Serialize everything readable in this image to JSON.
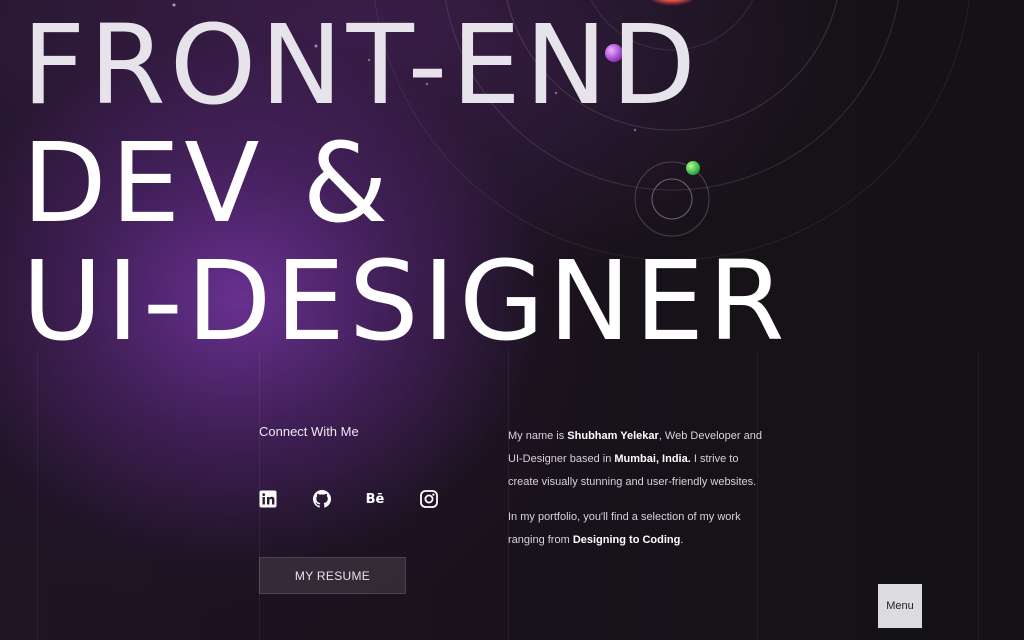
{
  "hero": {
    "line1": "FRONT-END",
    "line2": "DEV &",
    "line3": "UI-DESIGNER"
  },
  "connect": {
    "title": "Connect With Me",
    "socials": [
      {
        "icon": "linkedin-icon",
        "label": "in"
      },
      {
        "icon": "github-icon",
        "label": ""
      },
      {
        "icon": "behance-icon",
        "label": "Bē"
      },
      {
        "icon": "instagram-icon",
        "label": ""
      }
    ]
  },
  "resume_button": "MY RESUME",
  "bio": {
    "p1_a": "My name is ",
    "p1_name": "Shubham Yelekar",
    "p1_b": ", Web Developer and UI-Designer based in ",
    "p1_loc": "Mumbai, India.",
    "p1_c": " I strive to create visually stunning and user-friendly websites.",
    "p2_a": "In my portfolio, you'll find a selection of my work ranging from ",
    "p2_b": "Designing to Coding",
    "p2_c": "."
  },
  "menu_button": "Menu",
  "colors": {
    "accent_purple": "#6c3296",
    "background": "#141214",
    "menu_bg": "#dcdce0"
  }
}
